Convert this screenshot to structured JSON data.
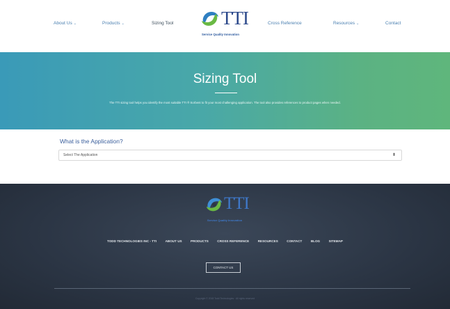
{
  "header": {
    "nav_left": [
      {
        "label": "About Us",
        "has_dropdown": true
      },
      {
        "label": "Products",
        "has_dropdown": true
      },
      {
        "label": "Sizing Tool",
        "has_dropdown": false
      }
    ],
    "nav_right": [
      {
        "label": "Cross Reference",
        "has_dropdown": false
      },
      {
        "label": "Resources",
        "has_dropdown": true
      },
      {
        "label": "Contact",
        "has_dropdown": false
      }
    ],
    "caret": "⌄",
    "logo": {
      "text": "TTI",
      "tagline": "Service Quality Innovation"
    }
  },
  "hero": {
    "title": "Sizing Tool",
    "description": "The TTI sizing tool helps you identify the most suitable TTI ® Sorbent to fit your most challenging application. The tool also provides references to product pages when needed."
  },
  "application": {
    "label": "What is the Application?",
    "select_value": "Select The Application",
    "select_caret": "⬍"
  },
  "footer": {
    "logo": {
      "text": "TTI",
      "tagline": "Service Quality Innovation"
    },
    "nav": [
      "TODD TECHNOLOGIES INC - TTI",
      "ABOUT US",
      "PRODUCTS",
      "CROSS REFERENCE",
      "RESOURCES",
      "CONTACT",
      "BLOG",
      "SITEMAP"
    ],
    "contact_button": "CONTACT US",
    "copyright": "Copyright © 2018 Todd Technologies · All rights reserved"
  },
  "colors": {
    "nav_link": "#4a7fb0",
    "brand_blue": "#2d4a8c",
    "hero_start": "#3a9ab8",
    "hero_end": "#5fb67c",
    "footer_bg": "#2b3544"
  }
}
